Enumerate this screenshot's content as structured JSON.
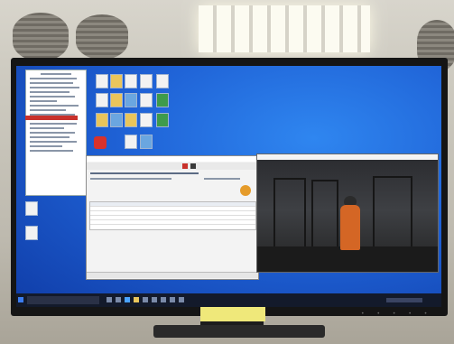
{
  "scene": {
    "description_visible": "",
    "colors": {
      "desktop_blue": "#1f62d6",
      "taskbar": "#131a2b",
      "sticker": "#efe87a",
      "orange_figure": "#d46625"
    }
  },
  "icons": [
    "reel-icon",
    "monitor-icon",
    "desktop-file-icon",
    "folder-icon",
    "stop-sign-icon",
    "camera-view-icon",
    "search-icon",
    "windows-start-icon"
  ]
}
